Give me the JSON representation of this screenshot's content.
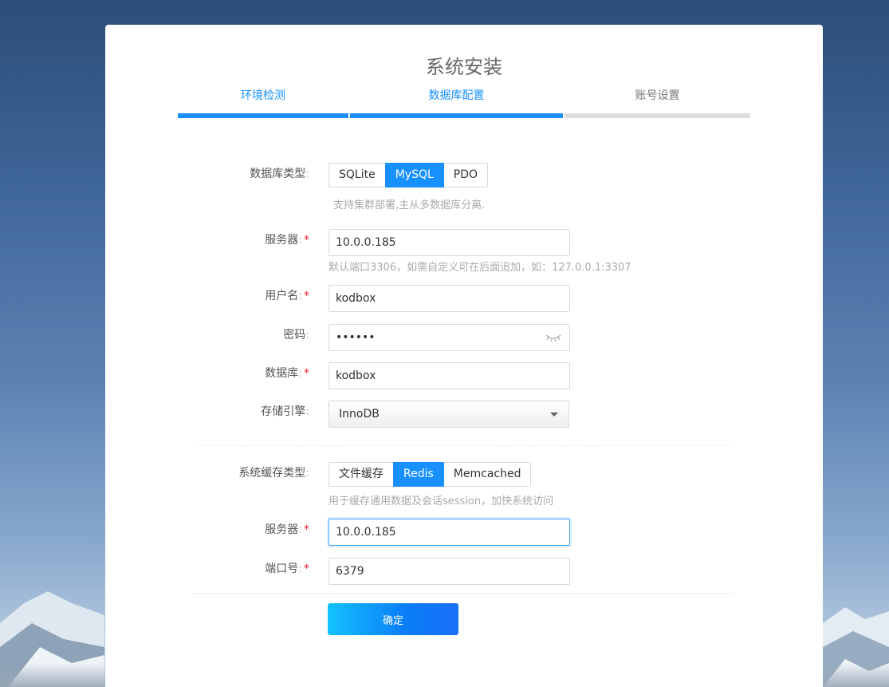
{
  "page": {
    "title": "系统安装"
  },
  "steps": [
    {
      "label": "环境检测",
      "status": "done"
    },
    {
      "label": "数据库配置",
      "status": "done"
    },
    {
      "label": "账号设置",
      "status": "todo"
    }
  ],
  "colors": {
    "accent": "#1890ff",
    "required": "#f5222d",
    "hint": "#aaaaaa"
  },
  "db": {
    "type_label": "数据库类型",
    "type_options": [
      "SQLite",
      "MySQL",
      "PDO"
    ],
    "type_selected": "MySQL",
    "type_hint": "支持集群部署,主从多数据库分离.",
    "server_label": "服务器",
    "server_value": "10.0.0.185",
    "server_hint": "默认端口3306，如需自定义可在后面追加，如：127.0.0.1:3307",
    "user_label": "用户名",
    "user_value": "kodbox",
    "password_label": "密码",
    "password_value": "••••••",
    "password_icon": "eye-closed-icon",
    "name_label": "数据库",
    "name_value": "kodbox",
    "engine_label": "存储引擎",
    "engine_value": "InnoDB"
  },
  "cache": {
    "type_label": "系统缓存类型",
    "type_options": [
      "文件缓存",
      "Redis",
      "Memcached"
    ],
    "type_selected": "Redis",
    "type_hint": "用于缓存通用数据及会话session，加快系统访问",
    "server_label": "服务器",
    "server_value": "10.0.0.185",
    "port_label": "端口号",
    "port_value": "6379"
  },
  "label_suffix": ":",
  "required_mark": "*",
  "submit_label": "确定"
}
